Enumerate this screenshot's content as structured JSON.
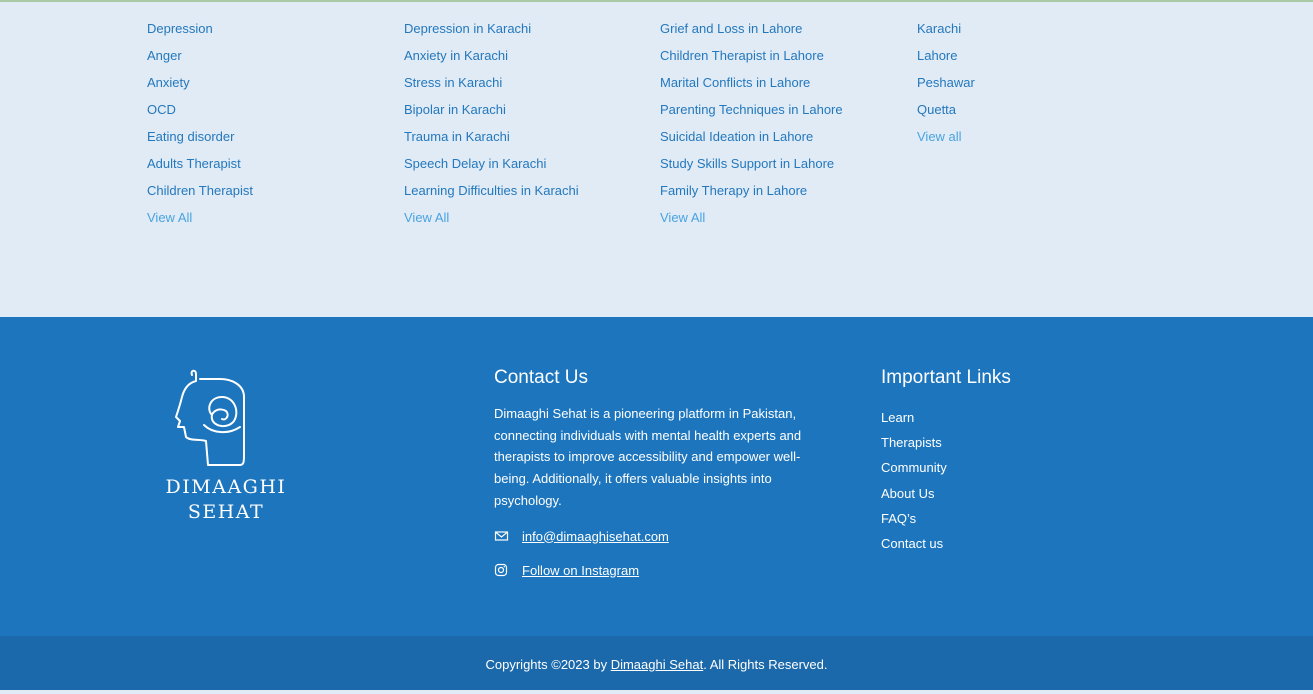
{
  "columns": [
    {
      "items": [
        "Depression",
        "Anger",
        "Anxiety",
        "OCD",
        "Eating disorder",
        "Adults Therapist",
        "Children Therapist"
      ],
      "view_all": "View All"
    },
    {
      "items": [
        "Depression in Karachi",
        "Anxiety in Karachi",
        "Stress in Karachi",
        "Bipolar in Karachi",
        "Trauma in Karachi",
        "Speech Delay in Karachi",
        "Learning Difficulties in Karachi"
      ],
      "view_all": "View All"
    },
    {
      "items": [
        "Grief and Loss in Lahore",
        "Children Therapist in Lahore",
        "Marital Conflicts in Lahore",
        "Parenting Techniques in Lahore",
        "Suicidal Ideation in Lahore",
        "Study Skills Support in Lahore",
        "Family Therapy in Lahore"
      ],
      "view_all": "View All"
    },
    {
      "items": [
        "Karachi",
        "Lahore",
        "Peshawar",
        "Quetta"
      ],
      "view_all": "View all"
    }
  ],
  "logo": {
    "line1": "DIMAAGHI",
    "line2": "SEHAT"
  },
  "contact": {
    "heading": "Contact Us",
    "description": "Dimaaghi Sehat is a pioneering platform in Pakistan, connecting individuals with mental health experts and therapists to improve accessibility and empower well-being. Additionally, it offers valuable insights into psychology.",
    "email": " info@dimaaghisehat.com",
    "instagram": " Follow on Instagram"
  },
  "important_links": {
    "heading": "Important Links",
    "items": [
      "Learn",
      "Therapists",
      "Community",
      "About Us",
      "FAQ’s",
      "Contact us"
    ]
  },
  "copyright": {
    "prefix": "Copyrights ©2023 by ",
    "link": "Dimaaghi Sehat",
    "suffix": ". All Rights Reserved."
  },
  "colors": {
    "link": "#2478bd",
    "view_all": "#4aa3e0",
    "footer_bg": "#1c75bd",
    "bottom_bg": "#1b69aa",
    "top_bg": "#e0ebf6"
  }
}
